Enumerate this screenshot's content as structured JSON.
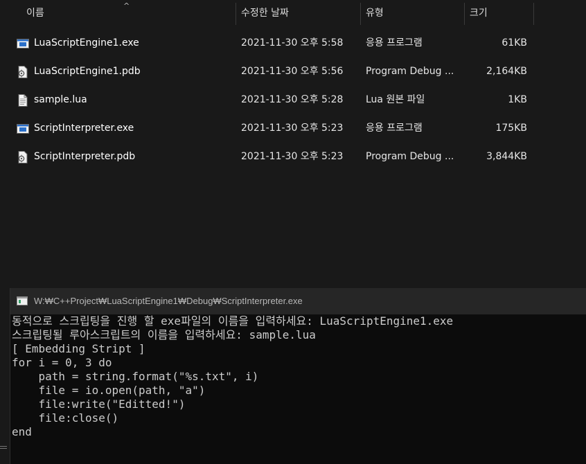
{
  "explorer": {
    "columns": {
      "name": "이름",
      "modified": "수정한 날짜",
      "type": "유형",
      "size": "크기"
    },
    "files": [
      {
        "name": "LuaScriptEngine1.exe",
        "modified": "2021-11-30 오후 5:58",
        "type": "응용 프로그램",
        "size": "61KB",
        "icon": "application-icon"
      },
      {
        "name": "LuaScriptEngine1.pdb",
        "modified": "2021-11-30 오후 5:56",
        "type": "Program Debug ...",
        "size": "2,164KB",
        "icon": "debug-file-icon"
      },
      {
        "name": "sample.lua",
        "modified": "2021-11-30 오후 5:28",
        "type": "Lua 원본 파일",
        "size": "1KB",
        "icon": "text-file-icon"
      },
      {
        "name": "ScriptInterpreter.exe",
        "modified": "2021-11-30 오후 5:23",
        "type": "응용 프로그램",
        "size": "175KB",
        "icon": "application-icon"
      },
      {
        "name": "ScriptInterpreter.pdb",
        "modified": "2021-11-30 오후 5:23",
        "type": "Program Debug ...",
        "size": "3,844KB",
        "icon": "debug-file-icon"
      }
    ]
  },
  "console": {
    "title": "W:₩C++Project₩LuaScriptEngine1₩Debug₩ScriptInterpreter.exe",
    "lines": [
      "동적으로 스크립팅을 진행 할 exe파일의 이름을 입력하세요: LuaScriptEngine1.exe",
      "스크립팅될 루아스크립트의 이름을 입력하세요: sample.lua",
      "[ Embedding Stript ]",
      "for i = 0, 3 do",
      "    path = string.format(\"%s.txt\", i)",
      "    file = io.open(path, \"a\")",
      "    file:write(\"Editted!\")",
      "    file:close()",
      "end"
    ]
  },
  "colors": {
    "background": "#191919",
    "console_bg": "#0c0c0c",
    "titlebar": "#262626",
    "text": "#ffffff"
  }
}
